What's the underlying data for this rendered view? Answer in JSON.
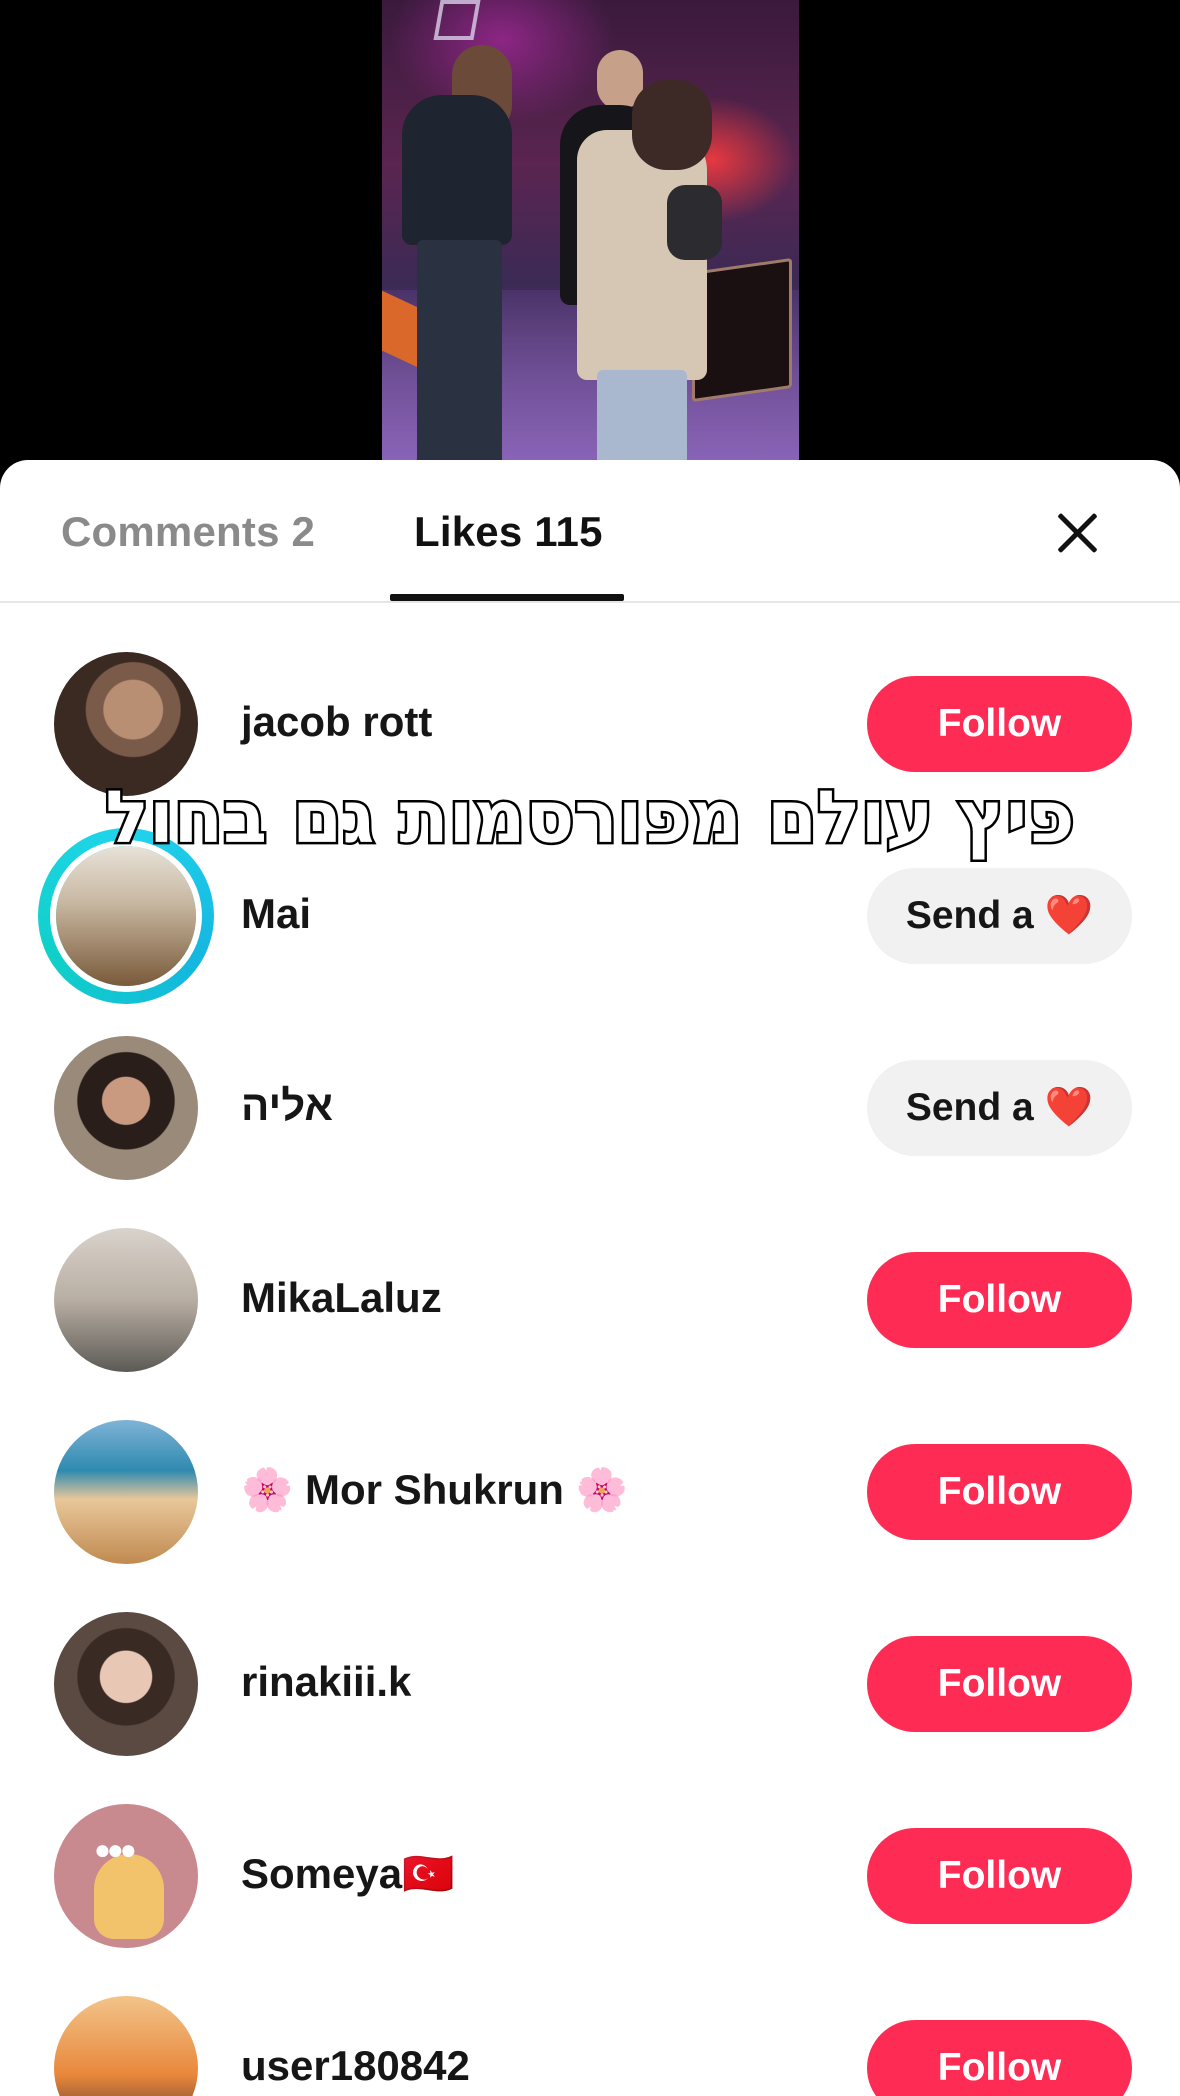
{
  "tabs": {
    "comments_label": "Comments 2",
    "likes_label": "Likes 115"
  },
  "caption": "פיץ עולם מפורסמות גם בחול",
  "users": [
    {
      "name": "jacob rott",
      "action": "Follow",
      "type": "follow"
    },
    {
      "name": "Mai",
      "action": "Send a ❤️",
      "type": "send"
    },
    {
      "name": "אליה",
      "action": "Send a ❤️",
      "type": "send"
    },
    {
      "name": "MikaLaluz",
      "action": "Follow",
      "type": "follow"
    },
    {
      "name": "🌸 Mor Shukrun 🌸",
      "action": "Follow",
      "type": "follow"
    },
    {
      "name": "rinakiii.k",
      "action": "Follow",
      "type": "follow"
    },
    {
      "name": "Someya🇹🇷",
      "action": "Follow",
      "type": "follow"
    },
    {
      "name": "user180842",
      "action": "Follow",
      "type": "follow"
    }
  ],
  "icons": {
    "close": "close-icon"
  },
  "colors": {
    "follow_button": "#fe2c55",
    "send_button": "#f1f1f2",
    "story_ring": "#20d5ec"
  }
}
